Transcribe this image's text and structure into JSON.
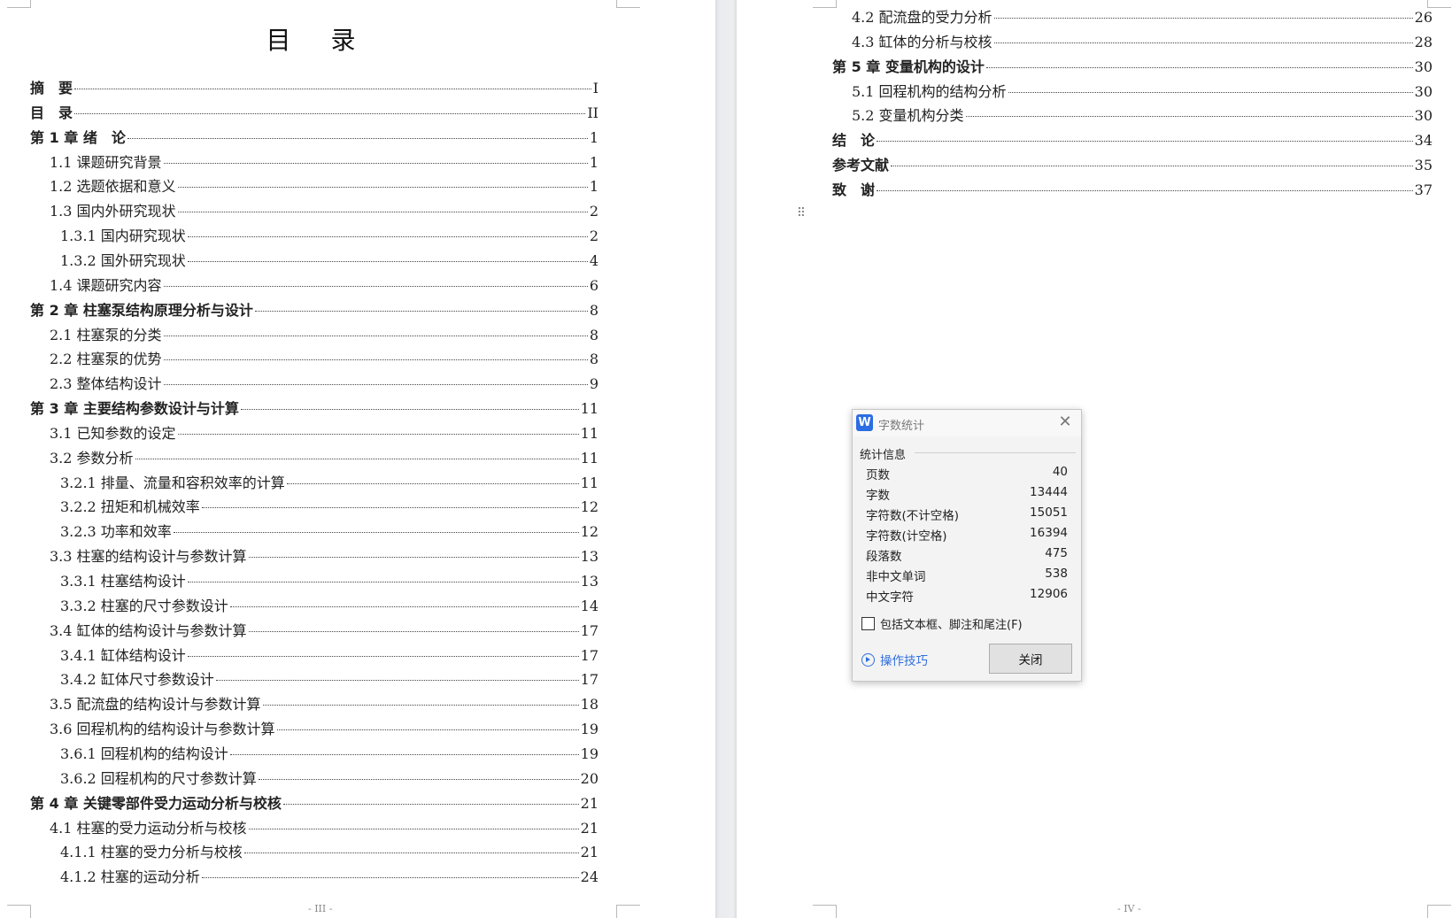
{
  "left_page": {
    "title": "目 录",
    "page_number": "- III -",
    "toc": [
      {
        "level": 0,
        "label": "摘　要",
        "page": "I"
      },
      {
        "level": 0,
        "label": "目　录",
        "page": "II"
      },
      {
        "level": 0,
        "label": "第 1 章  绪　论",
        "page": "1"
      },
      {
        "level": 1,
        "label": "1.1  课题研究背景",
        "page": "1"
      },
      {
        "level": 1,
        "label": "1.2  选题依据和意义",
        "page": "1"
      },
      {
        "level": 1,
        "label": "1.3  国内外研究现状",
        "page": "2"
      },
      {
        "level": 2,
        "label": "1.3.1  国内研究现状",
        "page": "2"
      },
      {
        "level": 2,
        "label": "1.3.2  国外研究现状",
        "page": "4"
      },
      {
        "level": 1,
        "label": "1.4  课题研究内容",
        "page": "6"
      },
      {
        "level": 0,
        "label": "第 2 章  柱塞泵结构原理分析与设计",
        "page": "8"
      },
      {
        "level": 1,
        "label": "2.1  柱塞泵的分类",
        "page": "8"
      },
      {
        "level": 1,
        "label": "2.2  柱塞泵的优势",
        "page": "8"
      },
      {
        "level": 1,
        "label": "2.3  整体结构设计",
        "page": "9"
      },
      {
        "level": 0,
        "label": "第 3 章  主要结构参数设计与计算",
        "page": "11"
      },
      {
        "level": 1,
        "label": "3.1  已知参数的设定",
        "page": "11"
      },
      {
        "level": 1,
        "label": "3.2  参数分析",
        "page": "11"
      },
      {
        "level": 2,
        "label": "3.2.1  排量、流量和容积效率的计算",
        "page": "11"
      },
      {
        "level": 2,
        "label": "3.2.2  扭矩和机械效率",
        "page": "12"
      },
      {
        "level": 2,
        "label": "3.2.3  功率和效率",
        "page": "12"
      },
      {
        "level": 1,
        "label": "3.3  柱塞的结构设计与参数计算",
        "page": "13"
      },
      {
        "level": 2,
        "label": "3.3.1  柱塞结构设计",
        "page": "13"
      },
      {
        "level": 2,
        "label": "3.3.2  柱塞的尺寸参数设计",
        "page": "14"
      },
      {
        "level": 1,
        "label": "3.4  缸体的结构设计与参数计算",
        "page": "17"
      },
      {
        "level": 2,
        "label": "3.4.1  缸体结构设计",
        "page": "17"
      },
      {
        "level": 2,
        "label": "3.4.2  缸体尺寸参数设计",
        "page": "17"
      },
      {
        "level": 1,
        "label": "3.5  配流盘的结构设计与参数计算",
        "page": "18"
      },
      {
        "level": 1,
        "label": "3.6  回程机构的结构设计与参数计算",
        "page": "19"
      },
      {
        "level": 2,
        "label": "3.6.1  回程机构的结构设计",
        "page": "19"
      },
      {
        "level": 2,
        "label": "3.6.2  回程机构的尺寸参数计算",
        "page": "20"
      },
      {
        "level": 0,
        "label": "第 4 章  关键零部件受力运动分析与校核",
        "page": "21"
      },
      {
        "level": 1,
        "label": "4.1  柱塞的受力运动分析与校核",
        "page": "21"
      },
      {
        "level": 2,
        "label": "4.1.1  柱塞的受力分析与校核",
        "page": "21"
      },
      {
        "level": 2,
        "label": "4.1.2  柱塞的运动分析",
        "page": "24"
      }
    ]
  },
  "right_page": {
    "page_number": "- IV -",
    "toc": [
      {
        "level": 1,
        "label": "4.2  配流盘的受力分析",
        "page": "26"
      },
      {
        "level": 1,
        "label": "4.3  缸体的分析与校核",
        "page": "28"
      },
      {
        "level": 0,
        "label": "第 5 章  变量机构的设计",
        "page": "30"
      },
      {
        "level": 1,
        "label": "5.1  回程机构的结构分析",
        "page": "30"
      },
      {
        "level": 1,
        "label": "5.2  变量机构分类",
        "page": "30"
      },
      {
        "level": 0,
        "label": "结　论",
        "page": "34"
      },
      {
        "level": 0,
        "label": "参考文献",
        "page": "35"
      },
      {
        "level": 0,
        "label": "致　谢",
        "page": "37"
      }
    ]
  },
  "dialog": {
    "logo": "W",
    "title": "字数统计",
    "close_glyph": "✕",
    "group_label": "统计信息",
    "stats": [
      {
        "label": "页数",
        "value": "40"
      },
      {
        "label": "字数",
        "value": "13444"
      },
      {
        "label": "字符数(不计空格)",
        "value": "15051"
      },
      {
        "label": "字符数(计空格)",
        "value": "16394"
      },
      {
        "label": "段落数",
        "value": "475"
      },
      {
        "label": "非中文单词",
        "value": "538"
      },
      {
        "label": "中文字符",
        "value": "12906"
      }
    ],
    "checkbox_label": "包括文本框、脚注和尾注(F)",
    "tips_label": "操作技巧",
    "close_button": "关闭"
  }
}
